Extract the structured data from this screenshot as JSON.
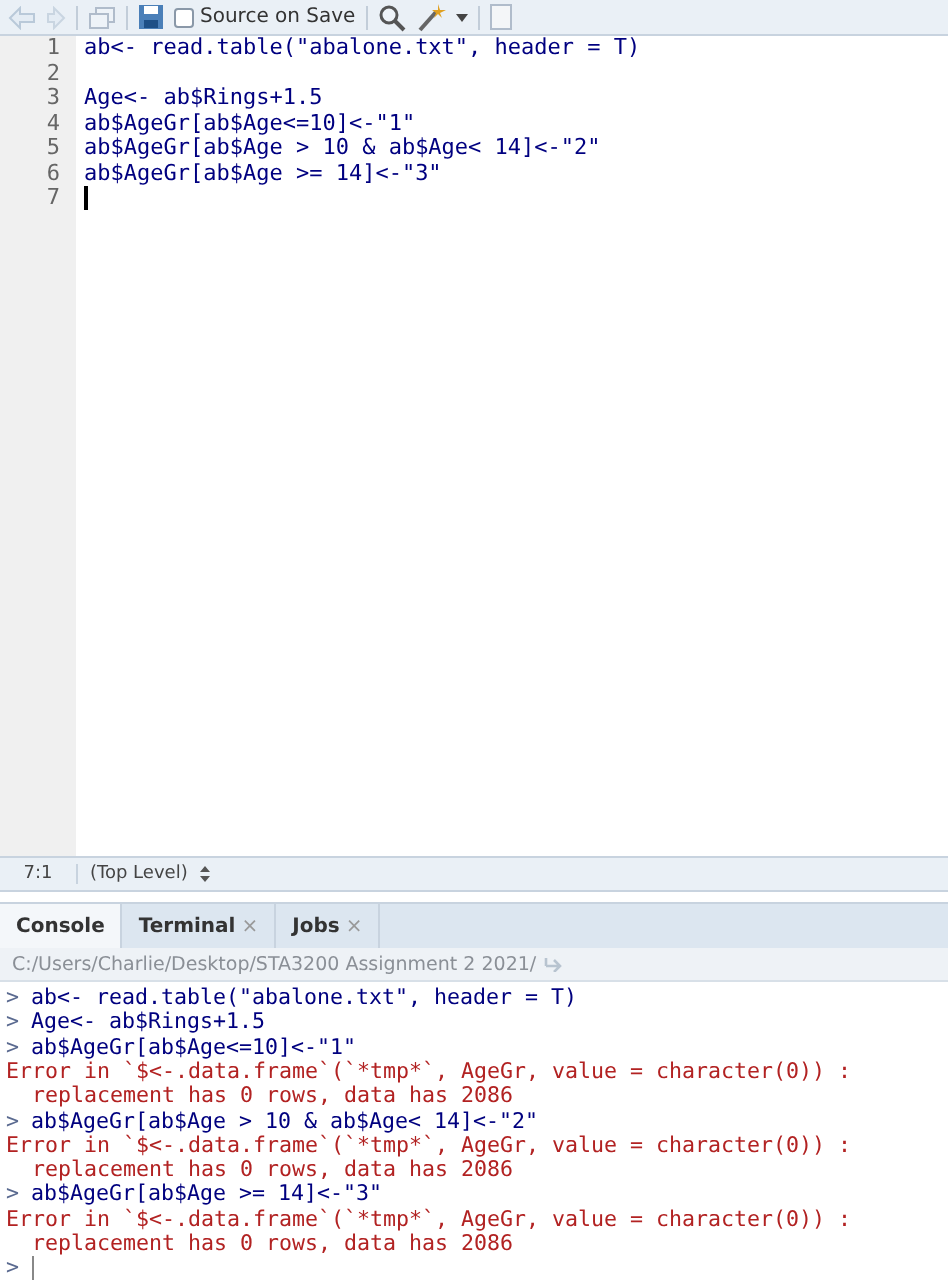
{
  "toolbar": {
    "source_on_save": {
      "label": "Source on Save",
      "checked": false
    }
  },
  "editor": {
    "lines": [
      {
        "number": "1",
        "code": "ab<- read.table(\"abalone.txt\", header = T)"
      },
      {
        "number": "2"
      },
      {
        "number": "3",
        "code": "Age<- ab$Rings+1.5"
      },
      {
        "number": "4",
        "code": "ab$AgeGr[ab$Age<=10]<-\"1\""
      },
      {
        "number": "5",
        "code": "ab$AgeGr[ab$Age > 10 & ab$Age< 14]<-\"2\""
      },
      {
        "number": "6",
        "code": "ab$AgeGr[ab$Age >= 14]<-\"3\""
      },
      {
        "number": "7",
        "cursor": true
      }
    ]
  },
  "status_bar": {
    "position": "7:1",
    "scope": "(Top Level)"
  },
  "tabs": [
    {
      "label": "Console",
      "selected": true
    },
    {
      "label": "Terminal",
      "selected": false,
      "close": "×"
    },
    {
      "label": "Jobs",
      "selected": false,
      "close": "×"
    }
  ],
  "console": {
    "path": "C:/Users/Charlie/Desktop/STA3200 Assignment 2 2021/",
    "lines": [
      {
        "kind": "input",
        "prompt": ">",
        "text": "ab<- read.table(\"abalone.txt\", header = T)"
      },
      {
        "kind": "input",
        "prompt": ">",
        "text": "Age<- ab$Rings+1.5"
      },
      {
        "kind": "input",
        "prompt": ">",
        "text": "ab$AgeGr[ab$Age<=10]<-\"1\""
      },
      {
        "kind": "error",
        "text": "Error in `$<-.data.frame`(`*tmp*`, AgeGr, value = character(0)) :"
      },
      {
        "kind": "error",
        "text": "  replacement has 0 rows, data has 2086"
      },
      {
        "kind": "input",
        "prompt": ">",
        "text": "ab$AgeGr[ab$Age > 10 & ab$Age< 14]<-\"2\""
      },
      {
        "kind": "error",
        "text": "Error in `$<-.data.frame`(`*tmp*`, AgeGr, value = character(0)) :"
      },
      {
        "kind": "error",
        "text": "  replacement has 0 rows, data has 2086"
      },
      {
        "kind": "input",
        "prompt": ">",
        "text": "ab$AgeGr[ab$Age >= 14]<-\"3\""
      },
      {
        "kind": "error",
        "text": "Error in `$<-.data.frame`(`*tmp*`, AgeGr, value = character(0)) :"
      },
      {
        "kind": "error",
        "text": "  replacement has 0 rows, data has 2086"
      },
      {
        "kind": "prompt",
        "prompt": ">",
        "cursor": true
      }
    ]
  }
}
